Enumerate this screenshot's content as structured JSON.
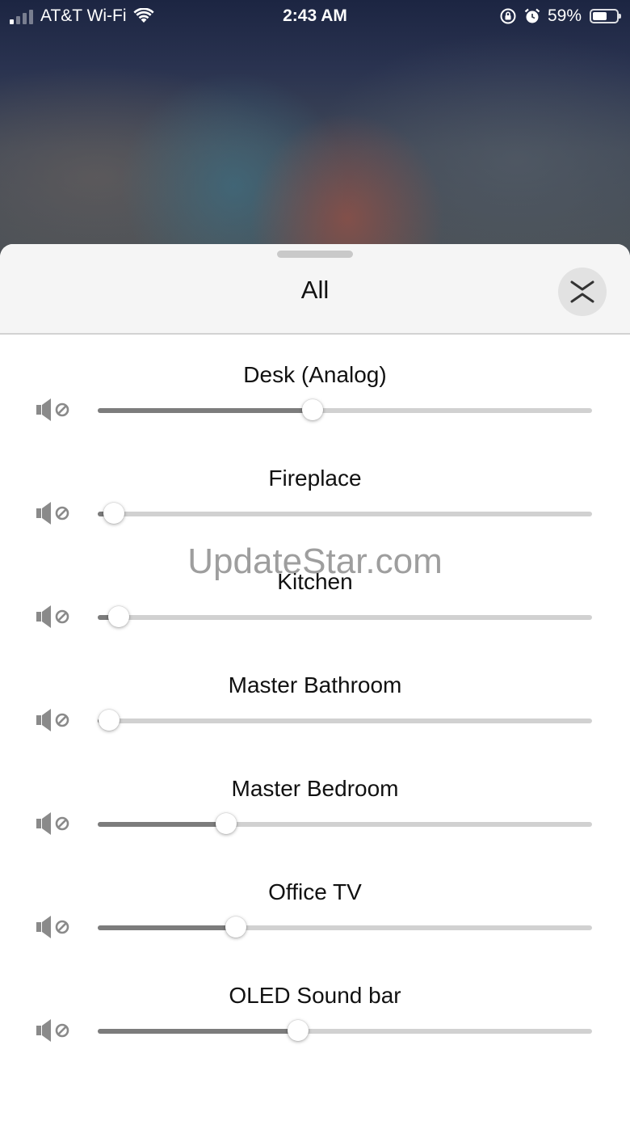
{
  "status_bar": {
    "carrier": "AT&T Wi-Fi",
    "time": "2:43 AM",
    "battery_percent": "59%",
    "battery_level": 0.59
  },
  "sheet": {
    "title": "All",
    "collapse_icon": "chevron-collapse-icon"
  },
  "rooms": [
    {
      "name": "Desk (Analog)",
      "volume": 0.435
    },
    {
      "name": "Fireplace",
      "volume": 0.033
    },
    {
      "name": "Kitchen",
      "volume": 0.042
    },
    {
      "name": "Master Bathroom",
      "volume": 0.023
    },
    {
      "name": "Master Bedroom",
      "volume": 0.26
    },
    {
      "name": "Office TV",
      "volume": 0.279
    },
    {
      "name": "OLED Sound bar",
      "volume": 0.405
    }
  ],
  "mute_icon": "speaker-muted-icon",
  "watermark": "UpdateStar.com"
}
